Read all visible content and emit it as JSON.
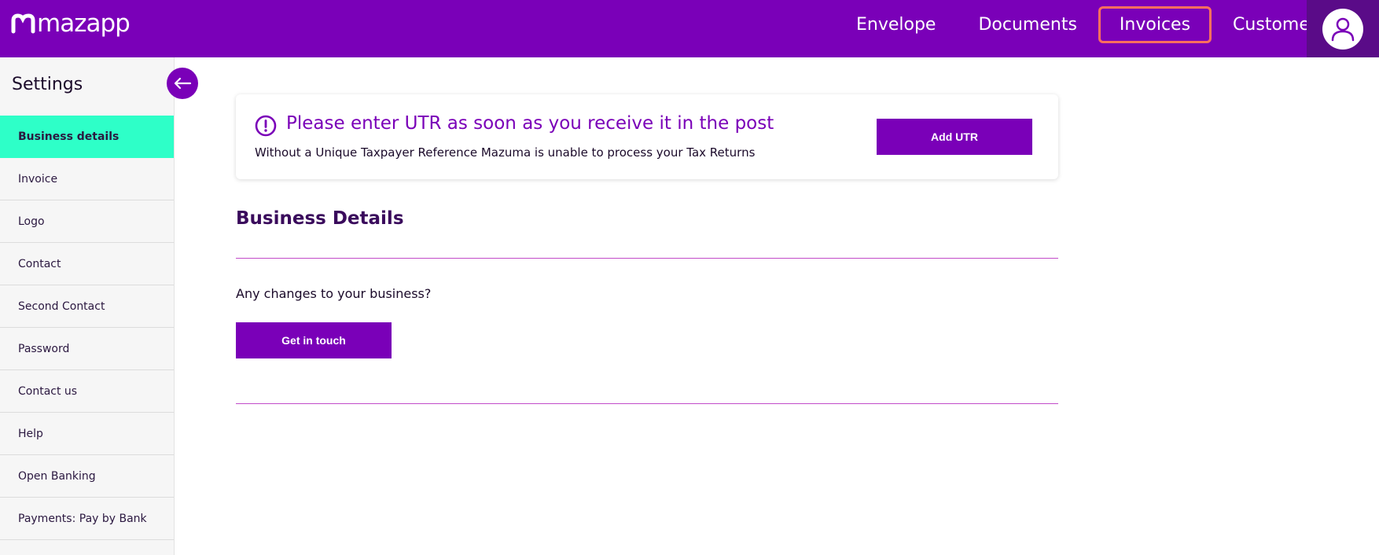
{
  "header": {
    "logo_text": "mazapp",
    "nav": [
      {
        "label": "Envelope",
        "active": false
      },
      {
        "label": "Documents",
        "active": false
      },
      {
        "label": "Invoices",
        "active": true
      },
      {
        "label": "Customers",
        "active": false
      }
    ],
    "avatar_icon": "user-icon"
  },
  "sidebar": {
    "title": "Settings",
    "back_icon": "arrow-left-icon",
    "items": [
      {
        "label": "Business details",
        "active": true
      },
      {
        "label": "Invoice"
      },
      {
        "label": "Logo"
      },
      {
        "label": "Contact"
      },
      {
        "label": "Second Contact"
      },
      {
        "label": "Password"
      },
      {
        "label": "Contact us"
      },
      {
        "label": "Help"
      },
      {
        "label": "Open Banking"
      },
      {
        "label": "Payments: Pay by Bank"
      }
    ]
  },
  "alert": {
    "icon": "exclamation-circle-icon",
    "title": "Please enter UTR as soon as you receive it in the post",
    "text": "Without a Unique Taxpayer Reference Mazuma is unable to process your Tax Returns",
    "button_label": "Add UTR"
  },
  "main": {
    "section_title": "Business Details",
    "changes_text": "Any changes to your business?",
    "contact_button_label": "Get in touch"
  },
  "colors": {
    "brand_purple": "#7a00b8",
    "active_mint": "#2effc8",
    "active_nav_border": "#ff6f5e",
    "divider": "#c24cc9"
  }
}
